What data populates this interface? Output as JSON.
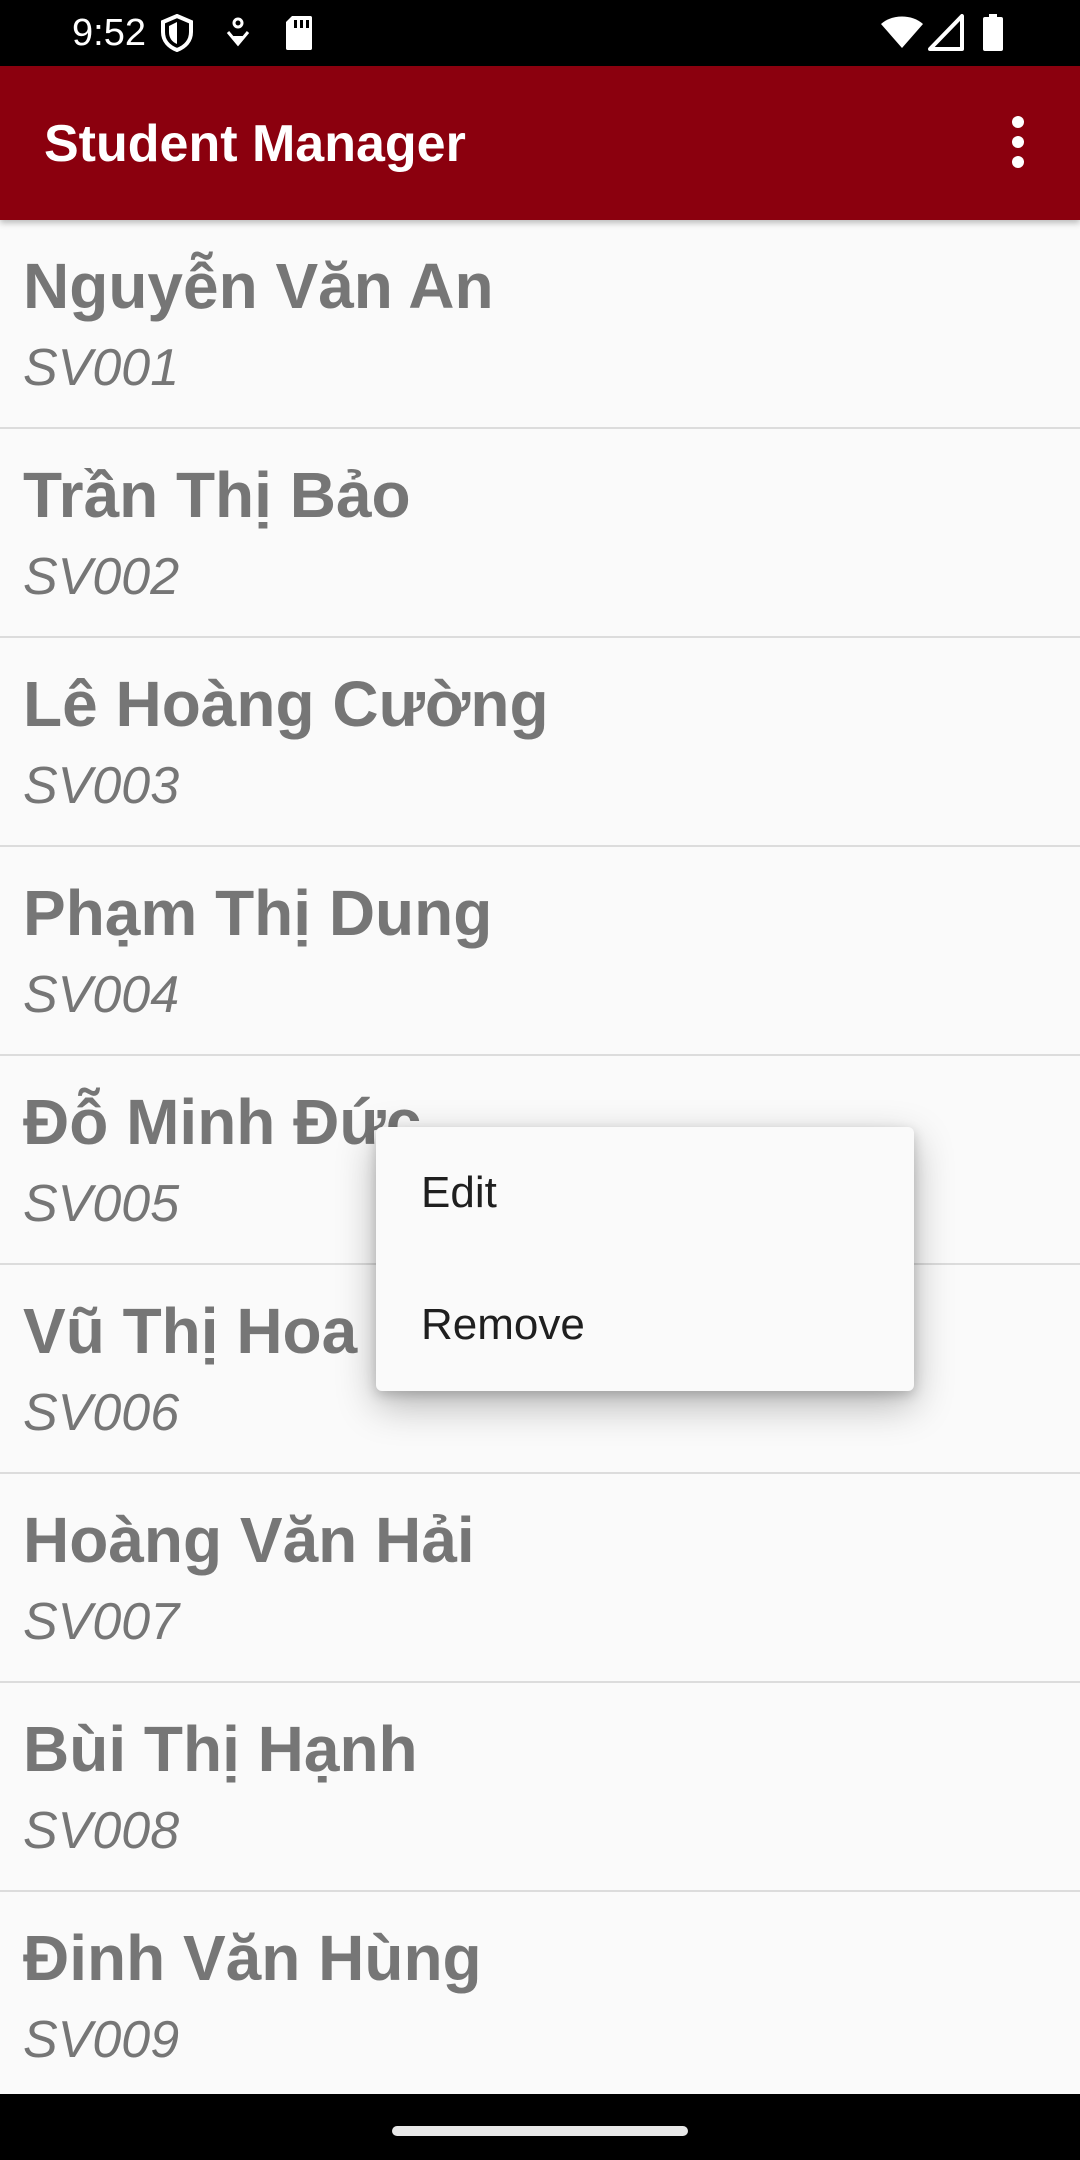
{
  "status_bar": {
    "time": "9:52",
    "icons": [
      "shield-icon",
      "location-icon",
      "sd-card-icon",
      "wifi-icon",
      "signal-icon",
      "battery-icon"
    ]
  },
  "app_bar": {
    "title": "Student Manager",
    "overflow_icon": "more-vert-icon",
    "background_color": "#8b000e"
  },
  "students": [
    {
      "name": "Nguyễn Văn An",
      "id": "SV001"
    },
    {
      "name": "Trần Thị Bảo",
      "id": "SV002"
    },
    {
      "name": "Lê Hoàng Cường",
      "id": "SV003"
    },
    {
      "name": "Phạm Thị Dung",
      "id": "SV004"
    },
    {
      "name": "Đỗ Minh Đức",
      "id": "SV005"
    },
    {
      "name": "Vũ Thị Hoa",
      "id": "SV006"
    },
    {
      "name": "Hoàng Văn Hải",
      "id": "SV007"
    },
    {
      "name": "Bùi Thị Hạnh",
      "id": "SV008"
    },
    {
      "name": "Đinh Văn Hùng",
      "id": "SV009"
    }
  ],
  "context_menu": {
    "items": [
      {
        "label": "Edit"
      },
      {
        "label": "Remove"
      }
    ]
  }
}
